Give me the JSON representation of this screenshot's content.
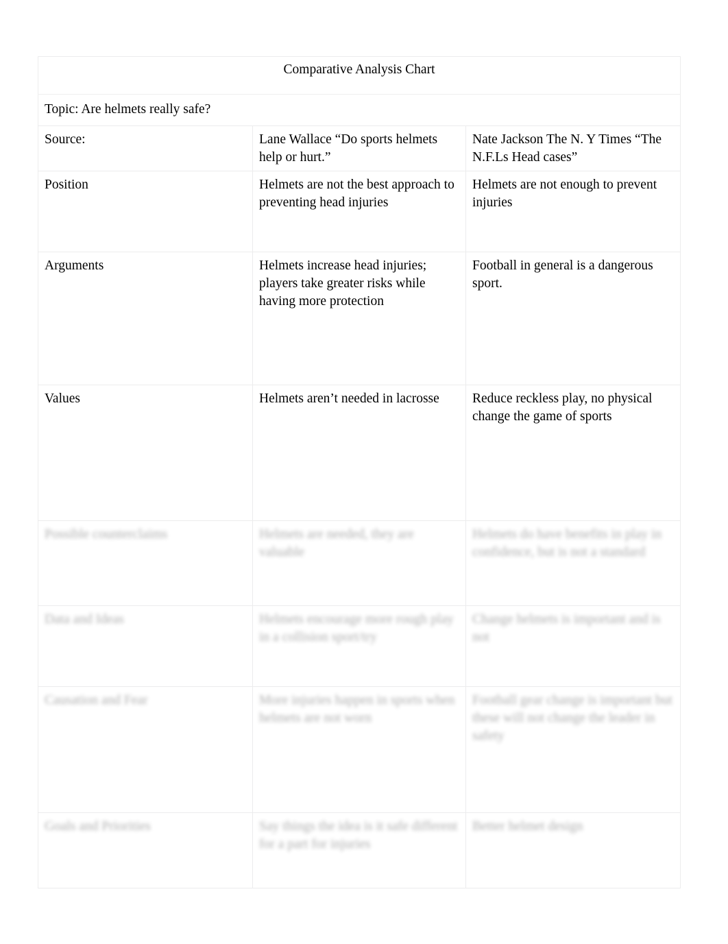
{
  "document": {
    "title": "Comparative Analysis Chart",
    "topic": "Topic: Are helmets really safe?"
  },
  "table": {
    "rows": [
      {
        "label": "Source:",
        "col2": "Lane Wallace “Do sports helmets help or hurt.”",
        "col3": "Nate Jackson The N. Y Times “The N.F.Ls Head cases”",
        "legible": true
      },
      {
        "label": "Position",
        "col2": "Helmets are not the best approach to preventing head injuries",
        "col3": "Helmets are not enough to prevent injuries",
        "legible": true
      },
      {
        "label": "Arguments",
        "col2": "Helmets increase head injuries; players take greater risks while having more protection",
        "col3": "Football in general is a dangerous sport.",
        "legible": true
      },
      {
        "label": "Values",
        "col2": "Helmets aren’t needed in lacrosse",
        "col3": "Reduce reckless play, no physical change the game of sports",
        "legible": true,
        "col3_blurred_tail": "change the game of sports"
      },
      {
        "label": "Possible counterclaims",
        "col2": "Helmets are needed, they are valuable",
        "col3": "Helmets do have benefits in play in confidence, but is not a standard",
        "legible": false
      },
      {
        "label": "Data and Ideas",
        "col2": "Helmets encourage more rough play in a collision sport/try",
        "col3": "Change helmets is important and is not",
        "legible": false
      },
      {
        "label": "Causation and Fear",
        "col2": "More injuries happen in sports when helmets are not worn",
        "col3": "Football gear change is important but these will not change the leader in safety",
        "legible": false
      },
      {
        "label": "Goals and Priorities",
        "col2": "Say things the idea is it safe different for a part for injuries",
        "col3": "Better helmet design",
        "legible": false
      }
    ]
  }
}
